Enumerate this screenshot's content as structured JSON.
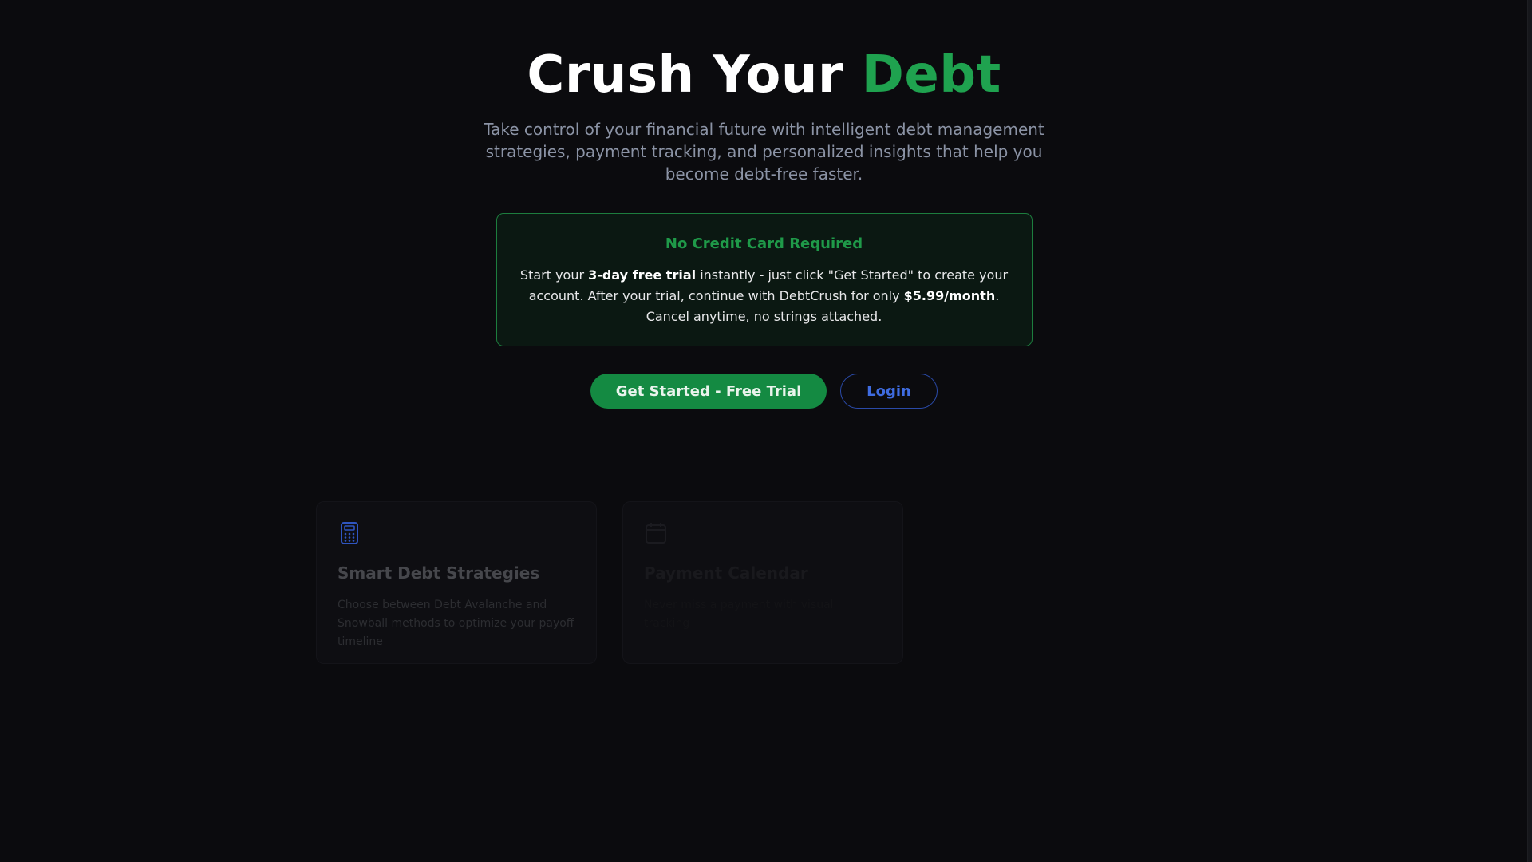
{
  "hero": {
    "title_main": "Crush Your",
    "title_accent": "Debt",
    "subtitle": "Take control of your financial future with intelligent debt management strategies, payment tracking, and personalized insights that help you become debt-free faster."
  },
  "notice": {
    "title": "No Credit Card Required",
    "body_start": "Start your ",
    "body_trial": "3-day free trial",
    "body_mid": " instantly - just click \"Get Started\" to create your account. After your trial, continue with DebtCrush for only ",
    "body_price": "$5.99/month",
    "body_end": ". Cancel anytime, no strings attached."
  },
  "actions": {
    "primary_label": "Get Started - Free Trial",
    "secondary_label": "Login"
  },
  "features": [
    {
      "icon": "calculator-icon",
      "title": "Smart Debt Strategies",
      "description": "Choose between Debt Avalanche and Snowball methods to optimize your payoff timeline"
    },
    {
      "icon": "calendar-icon",
      "title": "Payment Calendar",
      "description": "Never miss a payment with visual tracking"
    }
  ],
  "colors": {
    "background": "#0b0b0e",
    "accent_green": "#1fa24f",
    "primary_button": "#148a42",
    "login_blue": "#3f6ce0"
  }
}
